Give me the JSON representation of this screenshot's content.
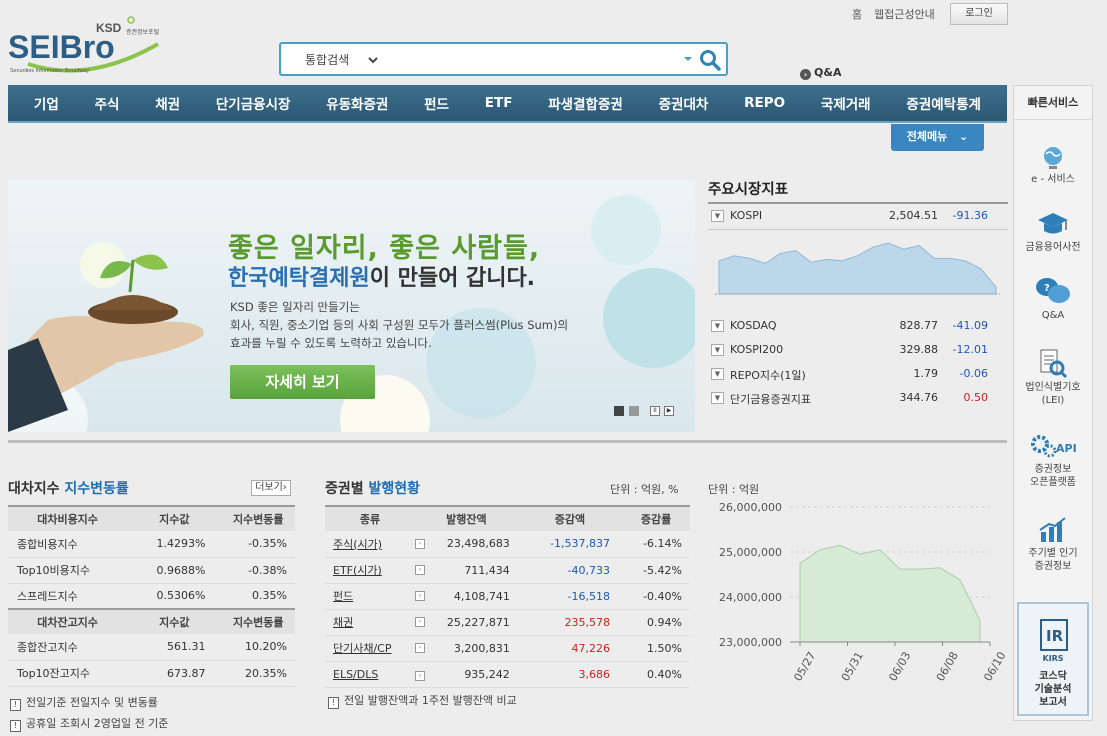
{
  "header": {
    "logo_text": "SEIBro",
    "logo_ksd": "KSD",
    "logo_sub_kr": "증권정보포털",
    "logo_tagline": "Securities Information Broadway",
    "util_links": [
      "홈",
      "웹접근성안내"
    ],
    "login_label": "로그인",
    "search_category": "통합검색",
    "qa_label": "Q&A"
  },
  "nav": {
    "items": [
      "기업",
      "주식",
      "채권",
      "단기금융시장",
      "유동화증권",
      "펀드",
      "ETF",
      "파생결합증권",
      "증권대차",
      "REPO",
      "국제거래",
      "증권예탁통계"
    ],
    "all_menu_label": "전체메뉴"
  },
  "quick": {
    "title": "빠른서비스",
    "items": [
      "e - 서비스",
      "금융용어사전",
      "Q&A",
      "법인식별기호\n(LEI)",
      "증권정보\n오픈플랫폼",
      "주기별 인기\n증권정보"
    ],
    "kosdaq_label": "코스닥\n기술분석\n보고서",
    "kirs_label": "KIRS"
  },
  "banner": {
    "title1": "좋은 일자리, 좋은 사람들,",
    "title2_hl": "한국예탁결제원",
    "title2_rest": "이 만들어 갑니다.",
    "body": [
      "KSD 좋은 일자리 만들기는",
      "회사, 직원, 중소기업 등의 사회 구성원 모두가 플러스썸(Plus Sum)의",
      "효과를 누릴 수 있도록 노력하고 있습니다."
    ],
    "button_label": "자세히 보기"
  },
  "market": {
    "title": "주요시장지표",
    "rows": [
      {
        "name": "KOSPI",
        "value": "2,504.51",
        "change": "-91.36",
        "dir": "dn"
      },
      {
        "name": "KOSDAQ",
        "value": "828.77",
        "change": "-41.09",
        "dir": "dn"
      },
      {
        "name": "KOSPI200",
        "value": "329.88",
        "change": "-12.01",
        "dir": "dn"
      },
      {
        "name": "REPO지수(1일)",
        "value": "1.79",
        "change": "-0.06",
        "dir": "dn"
      },
      {
        "name": "단기금융증권지표",
        "value": "344.76",
        "change": "0.50",
        "dir": "up"
      }
    ]
  },
  "lending": {
    "title_prefix": "대차지수",
    "title_hl": "지수변동률",
    "more_label": "더보기",
    "head1": [
      "대차비용지수",
      "지수값",
      "지수변동률"
    ],
    "rows1": [
      [
        "종합비용지수",
        "1.4293%",
        "-0.35%"
      ],
      [
        "Top10비용지수",
        "0.9688%",
        "-0.38%"
      ],
      [
        "스프레드지수",
        "0.5306%",
        "0.35%"
      ]
    ],
    "head2": [
      "대차잔고지수",
      "지수값",
      "지수변동률"
    ],
    "rows2": [
      [
        "종합잔고지수",
        "561.31",
        "10.20%"
      ],
      [
        "Top10잔고지수",
        "673.87",
        "20.35%"
      ]
    ],
    "notes": [
      "전일기준 전일지수 및 변동률",
      "공휴일 조회시 2영업일 전 기준"
    ]
  },
  "issuance": {
    "title_prefix": "증권별",
    "title_hl": "발행현황",
    "unit": "단위 : 억원, %",
    "head": [
      "종류",
      "발행잔액",
      "증감액",
      "증감률"
    ],
    "rows": [
      [
        "주식(시가)",
        "23,498,683",
        "-1,537,837",
        "-6.14%"
      ],
      [
        "ETF(시가)",
        "711,434",
        "-40,733",
        "-5.42%"
      ],
      [
        "펀드",
        "4,108,741",
        "-16,518",
        "-0.40%"
      ],
      [
        "채권",
        "25,227,871",
        "235,578",
        "0.94%"
      ],
      [
        "단기사채/CP",
        "3,200,831",
        "47,226",
        "1.50%"
      ],
      [
        "ELS/DLS",
        "935,242",
        "3,686",
        "0.40%"
      ]
    ],
    "note": "전일 발행잔액과 1주전 발행잔액 비교"
  },
  "chart_data": [
    {
      "type": "area",
      "title": "",
      "series": [
        {
          "values": [
            2555,
            2565,
            2560,
            2550,
            2570,
            2575,
            2552,
            2558,
            2555,
            2565,
            2582,
            2590,
            2578,
            2585,
            2560,
            2560,
            2555,
            2540,
            2504
          ]
        }
      ]
    },
    {
      "type": "area",
      "title": "",
      "unit": "단위 : 억원",
      "x": [
        "05/27",
        "05/31",
        "06/03",
        "06/08",
        "06/10"
      ],
      "ylim": [
        23000000,
        26000000
      ],
      "yticks": [
        "26,000,000",
        "25,000,000",
        "24,000,000",
        "23,000,000"
      ],
      "series": [
        {
          "values": [
            24750000,
            25050000,
            25150000,
            24950000,
            25050000,
            24620000,
            24620000,
            24650000,
            24380000,
            23480000
          ]
        }
      ]
    }
  ]
}
